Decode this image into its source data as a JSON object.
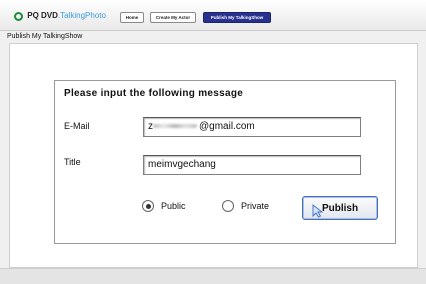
{
  "app": {
    "brand_main": "PQ DVD",
    "brand_accent": ".TalkingPhoto",
    "brand_icon": "q-logo-icon",
    "brand_color": "#1c8c3c",
    "accent_color": "#3a9ad9"
  },
  "nav": {
    "home": "Home",
    "create_actor": "Create My Actor",
    "publish_show": "Publish My TalkingShow",
    "active_color": "#28318f"
  },
  "page": {
    "subtitle": "Publish My TalkingShow"
  },
  "form": {
    "heading": "Please input the following message",
    "email_label": "E-Mail",
    "email_visible_prefix": "z",
    "email_visible_suffix": "@gmail.com",
    "title_label": "Title",
    "title_value": "meimvgechang",
    "radio_public": "Public",
    "radio_private": "Private",
    "selected_visibility": "Public",
    "publish_label": "Publish"
  }
}
